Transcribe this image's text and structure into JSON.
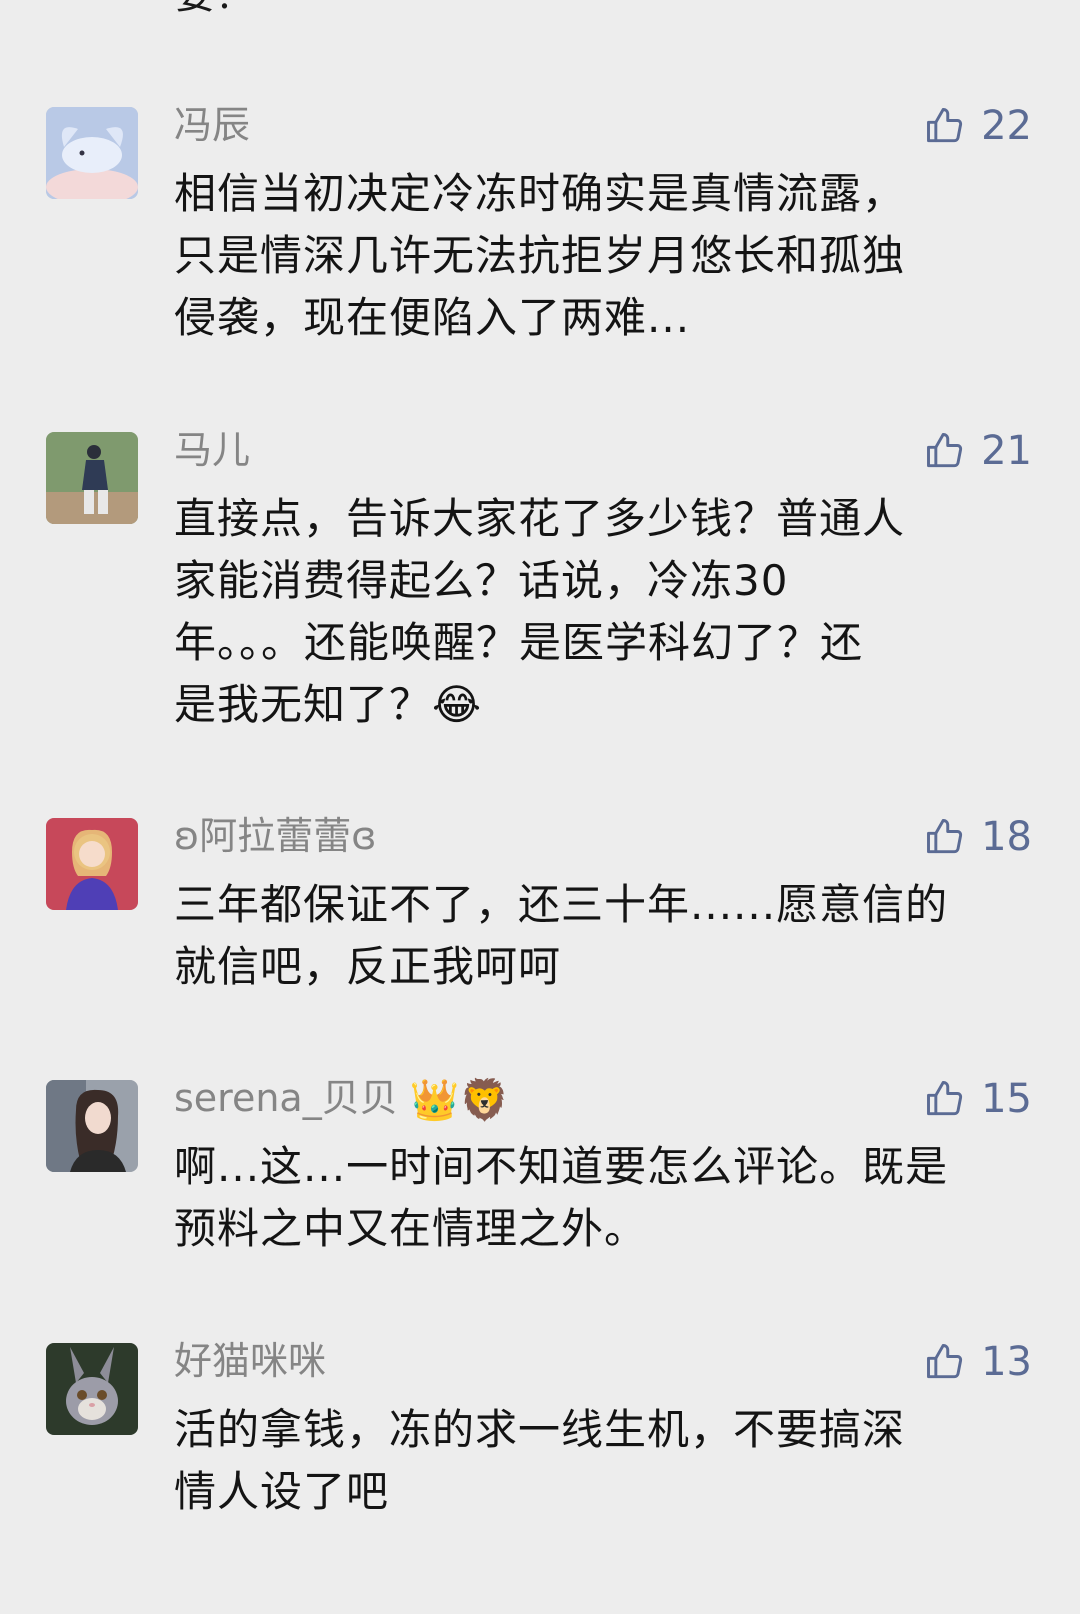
{
  "top_fragment": "要？",
  "comments": [
    {
      "name": "冯辰",
      "likes": "22",
      "lines": [
        "相信当初决定冷冻时确实是真情流露，",
        "只是情深几许无法抗拒岁月悠长和孤独",
        "侵袭，现在便陷入了两难..."
      ]
    },
    {
      "name": "马儿",
      "likes": "21",
      "lines": [
        "直接点，告诉大家花了多少钱？普通人",
        "家能消费得起么？话说，冷冻30",
        "年。。。还能唤醒？是医学科幻了？还",
        "是我无知了？😂"
      ]
    },
    {
      "name": "ʚ阿拉蕾蕾ɞ",
      "likes": "18",
      "lines": [
        "三年都保证不了，还三十年......愿意信的",
        "就信吧，反正我呵呵"
      ]
    },
    {
      "name": "serena_贝贝",
      "name_emoji": "👑🦁",
      "likes": "15",
      "lines": [
        "啊...这...一时间不知道要怎么评论。既是",
        "预料之中又在情理之外。"
      ]
    },
    {
      "name": "好猫咪咪",
      "likes": "13",
      "lines": [
        "活的拿钱，冻的求一线生机，不要搞深",
        "情人设了吧"
      ]
    }
  ],
  "icons": {
    "like": "thumbs-up-outline-icon"
  },
  "colors": {
    "background": "#ededed",
    "name": "#858585",
    "like": "#5b6b94",
    "text": "#141414"
  }
}
